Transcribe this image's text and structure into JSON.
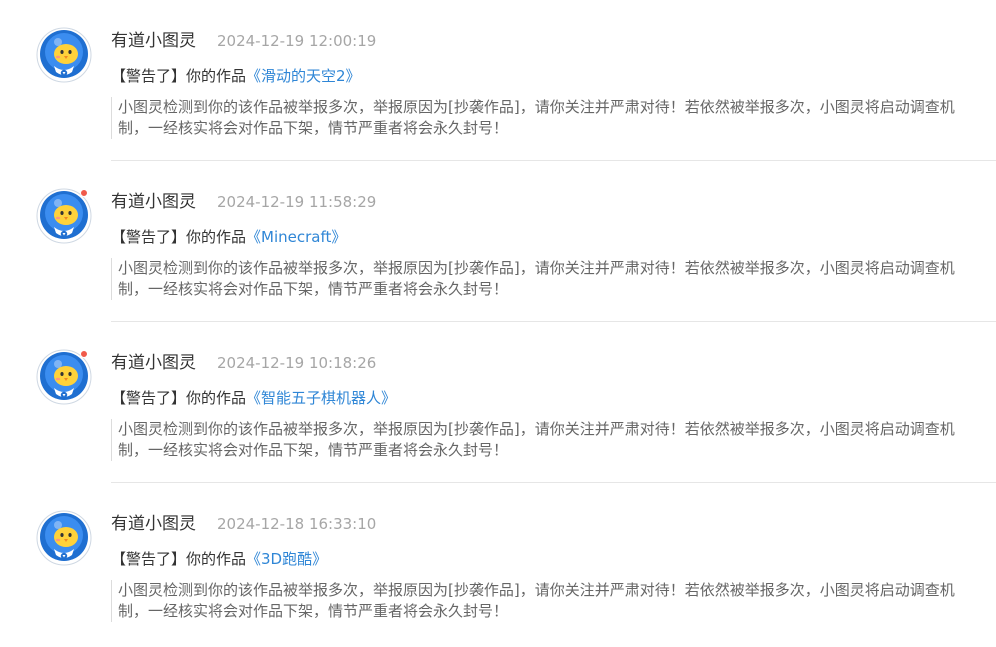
{
  "notifications": [
    {
      "sender": "有道小图灵",
      "time": "2024-12-19 12:00:19",
      "prefix": "【警告了】你的作品",
      "work_title": "《滑动的天空2》",
      "message": "小图灵检测到你的该作品被举报多次，举报原因为[抄袭作品]，请你关注并严肃对待！若依然被举报多次，小图灵将启动调查机制，一经核实将会对作品下架，情节严重者将会永久封号！",
      "unread": false
    },
    {
      "sender": "有道小图灵",
      "time": "2024-12-19 11:58:29",
      "prefix": "【警告了】你的作品",
      "work_title": "《Minecraft》",
      "message": "小图灵检测到你的该作品被举报多次，举报原因为[抄袭作品]，请你关注并严肃对待！若依然被举报多次，小图灵将启动调查机制，一经核实将会对作品下架，情节严重者将会永久封号！",
      "unread": true
    },
    {
      "sender": "有道小图灵",
      "time": "2024-12-19 10:18:26",
      "prefix": "【警告了】你的作品",
      "work_title": "《智能五子棋机器人》",
      "message": "小图灵检测到你的该作品被举报多次，举报原因为[抄袭作品]，请你关注并严肃对待！若依然被举报多次，小图灵将启动调查机制，一经核实将会对作品下架，情节严重者将会永久封号！",
      "unread": true
    },
    {
      "sender": "有道小图灵",
      "time": "2024-12-18 16:33:10",
      "prefix": "【警告了】你的作品",
      "work_title": "《3D跑酷》",
      "message": "小图灵检测到你的该作品被举报多次，举报原因为[抄袭作品]，请你关注并严肃对待！若依然被举报多次，小图灵将启动调查机制，一经核实将会对作品下架，情节严重者将会永久封号！",
      "unread": false
    }
  ],
  "colors": {
    "link": "#2f86d6",
    "unread_dot": "#f05a4a",
    "time": "#a6a6a6"
  },
  "icons": {
    "avatar": "robot-chick-avatar-icon"
  }
}
